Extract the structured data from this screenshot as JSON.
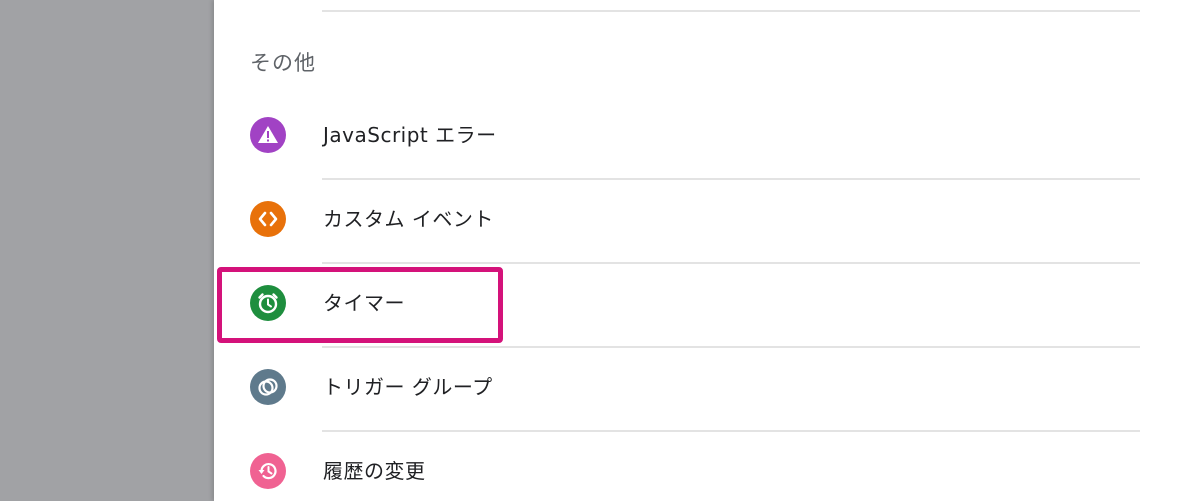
{
  "section": {
    "title": "その他"
  },
  "items": [
    {
      "label": "JavaScript エラー",
      "icon": "warning-triangle-icon",
      "color": "#a142c4"
    },
    {
      "label": "カスタム イベント",
      "icon": "code-brackets-icon",
      "color": "#e8710a"
    },
    {
      "label": "タイマー",
      "icon": "alarm-clock-icon",
      "color": "#1e8e3e"
    },
    {
      "label": "トリガー グループ",
      "icon": "trigger-group-icon",
      "color": "#5f7a8c"
    },
    {
      "label": "履歴の変更",
      "icon": "history-icon",
      "color": "#f06292"
    }
  ],
  "highlight_color": "#d4127a"
}
